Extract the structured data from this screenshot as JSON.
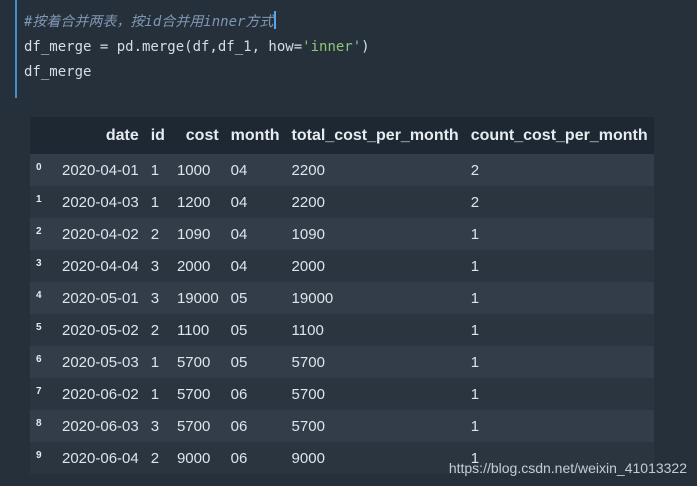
{
  "code_cell": {
    "comment": "#按着合并两表，按id合并用inner方式",
    "line2_pre": "df_merge = pd.merge(df,df_1, how=",
    "line2_str": "'inner'",
    "line2_post": ")",
    "line3": "df_merge"
  },
  "table": {
    "columns": [
      "date",
      "id",
      "cost",
      "month",
      "total_cost_per_month",
      "count_cost_per_month"
    ],
    "rows": [
      {
        "index": "0",
        "cells": [
          "2020-04-01",
          "1",
          "1000",
          "04",
          "2200",
          "2"
        ]
      },
      {
        "index": "1",
        "cells": [
          "2020-04-03",
          "1",
          "1200",
          "04",
          "2200",
          "2"
        ]
      },
      {
        "index": "2",
        "cells": [
          "2020-04-02",
          "2",
          "1090",
          "04",
          "1090",
          "1"
        ]
      },
      {
        "index": "3",
        "cells": [
          "2020-04-04",
          "3",
          "2000",
          "04",
          "2000",
          "1"
        ]
      },
      {
        "index": "4",
        "cells": [
          "2020-05-01",
          "3",
          "19000",
          "05",
          "19000",
          "1"
        ]
      },
      {
        "index": "5",
        "cells": [
          "2020-05-02",
          "2",
          "1100",
          "05",
          "1100",
          "1"
        ]
      },
      {
        "index": "6",
        "cells": [
          "2020-05-03",
          "1",
          "5700",
          "05",
          "5700",
          "1"
        ]
      },
      {
        "index": "7",
        "cells": [
          "2020-06-02",
          "1",
          "5700",
          "06",
          "5700",
          "1"
        ]
      },
      {
        "index": "8",
        "cells": [
          "2020-06-03",
          "3",
          "5700",
          "06",
          "5700",
          "1"
        ]
      },
      {
        "index": "9",
        "cells": [
          "2020-06-04",
          "2",
          "9000",
          "06",
          "9000",
          "1"
        ]
      }
    ]
  },
  "watermark": "https://blog.csdn.net/weixin_41013322"
}
